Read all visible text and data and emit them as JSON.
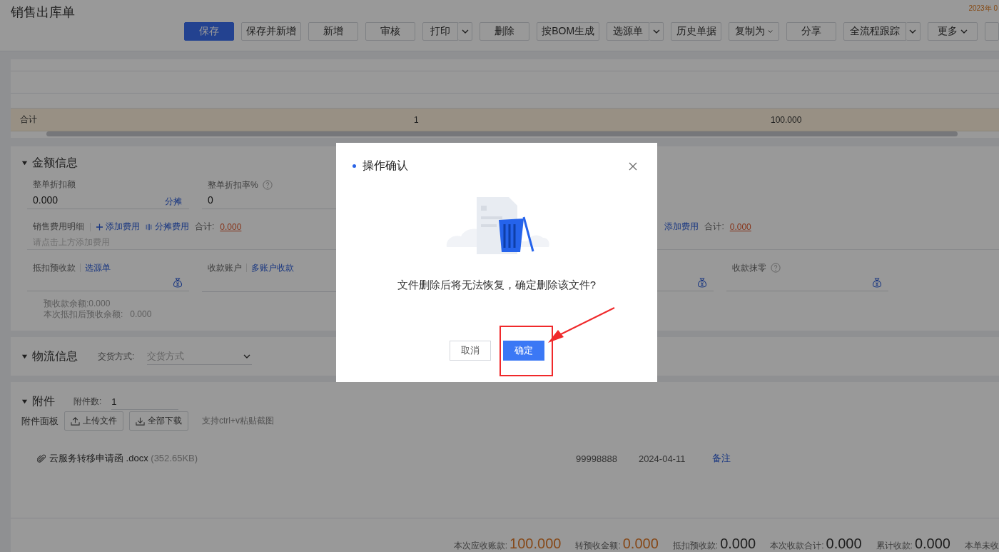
{
  "page": {
    "title": "销售出库单",
    "corner_text": "2023年 0"
  },
  "toolbar": [
    {
      "label": "保存",
      "kind": "primary"
    },
    {
      "label": "保存并新增",
      "kind": "plain"
    },
    {
      "label": "新增",
      "kind": "plain"
    },
    {
      "label": "审核",
      "kind": "plain"
    },
    {
      "label": "打印",
      "kind": "split"
    },
    {
      "label": "删除",
      "kind": "plain"
    },
    {
      "label": "按BOM生成",
      "kind": "plain"
    },
    {
      "label": "选源单",
      "kind": "split"
    },
    {
      "label": "历史单据",
      "kind": "plain"
    },
    {
      "label": "复制为",
      "kind": "menu"
    },
    {
      "label": "分享",
      "kind": "plain"
    },
    {
      "label": "全流程跟踪",
      "kind": "split"
    },
    {
      "label": "更多",
      "kind": "menu"
    }
  ],
  "grid": {
    "total_row": {
      "label": "合计",
      "quantity": "1",
      "amount": "100.000"
    }
  },
  "amount_section": {
    "title": "金额信息",
    "expanded": true,
    "discount": {
      "label": "整单折扣额",
      "value": "0.000",
      "action": "分摊"
    },
    "discount_rate": {
      "label": "整单折扣率%",
      "value": "0"
    },
    "fees": {
      "label": "销售费用明细",
      "add": "添加费用",
      "allocate": "分摊费用",
      "total_label": "合计:",
      "total": "0.000",
      "hint": "请点击上方添加费用"
    },
    "fees_right": {
      "add": "添加费用",
      "total_label": "合计:",
      "total": "0.000"
    },
    "prepayment": {
      "label": "抵扣预收款",
      "link": "选源单"
    },
    "account": {
      "label": "收款账户",
      "link": "多账户收款"
    },
    "rounding": {
      "label": "收款抹零"
    },
    "balance": {
      "label": "预收款余额:",
      "value": "0.000"
    },
    "balance_after": {
      "label": "本次抵扣后预收余额:",
      "value": "0.000"
    }
  },
  "logistics_section": {
    "title": "物流信息",
    "expanded": true,
    "delivery": {
      "label": "交货方式:",
      "placeholder": "交货方式"
    }
  },
  "attachments_section": {
    "title": "附件",
    "expanded": true,
    "count_label": "附件数:",
    "count": "1",
    "panel_label": "附件面板",
    "upload": "上传文件",
    "download_all": "全部下载",
    "hint": "支持ctrl+v粘贴截图",
    "files": [
      {
        "name": "云服务转移申请函 .docx",
        "size": "(352.65KB)",
        "uploader": "99998888",
        "date": "2024-04-11",
        "note": "备注"
      }
    ]
  },
  "summary": [
    {
      "label": "本次应收账款:",
      "value": "100.000",
      "kind": "accent"
    },
    {
      "label": "转预收金额:",
      "value": "0.000",
      "kind": "accent"
    },
    {
      "label": "抵扣预收款:",
      "value": "0.000",
      "kind": "plain"
    },
    {
      "label": "本次收款合计:",
      "value": "0.000",
      "kind": "plain"
    },
    {
      "label": "累计收款:",
      "value": "0.000",
      "kind": "plain"
    },
    {
      "label": "本单未收",
      "kind": "label"
    }
  ],
  "dialog": {
    "title": "操作确认",
    "message": "文件删除后将无法恢复，确定删除该文件?",
    "buttons": [
      {
        "label": "取消",
        "kind": "secondary",
        "highlighted": false
      },
      {
        "label": "确定",
        "kind": "primary",
        "highlighted": true
      }
    ]
  }
}
